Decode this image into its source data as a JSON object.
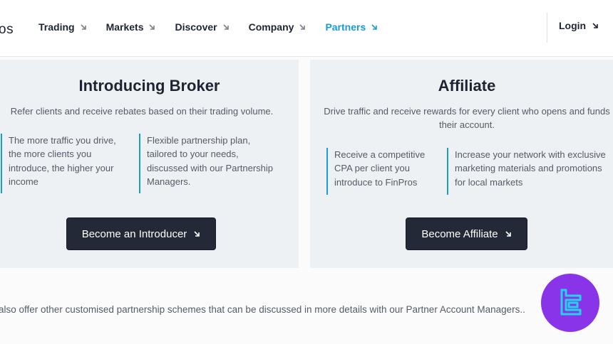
{
  "header": {
    "logo_fragment": "os",
    "nav": [
      {
        "label": "Trading"
      },
      {
        "label": "Markets"
      },
      {
        "label": "Discover"
      },
      {
        "label": "Company"
      },
      {
        "label": "Partners",
        "active": true
      }
    ],
    "login_label": "Login"
  },
  "introducing_broker": {
    "title": "Introducing Broker",
    "subtitle": "Refer clients and receive rebates based on their trading volume.",
    "features": [
      "The more traffic you drive, the more clients you introduce, the higher your income",
      "Flexible partnership plan, tailored to your needs, discussed with our Partnership Managers."
    ],
    "button_label": "Become an Introducer"
  },
  "affiliate": {
    "title": "Affiliate",
    "subtitle": "Drive traffic and receive rewards for every client who opens and funds their account.",
    "features": [
      "Receive a competitive CPA per client you introduce to FinPros",
      "Increase your network with exclusive marketing materials and promotions for local markets"
    ],
    "button_label": "Become Affiliate"
  },
  "footer_text": "also offer other customised partnership schemes that can be discussed in more details with our Partner Account Managers..",
  "colors": {
    "accent": "#1a9bd8",
    "button_bg": "#242937",
    "card_bg": "#eef1f3",
    "badge_bg": "#8a34ea",
    "badge_glyph": "#22d3ee"
  },
  "icons": {
    "nav_arrow": "arrow-down-right-icon",
    "badge": "tc-logo-icon"
  }
}
